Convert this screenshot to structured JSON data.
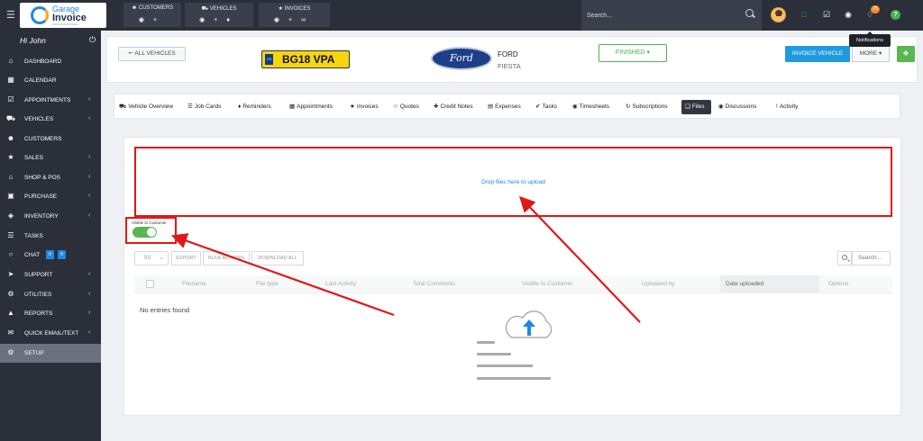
{
  "topbar": {
    "groups": [
      {
        "title": "CUSTOMERS",
        "icon": "user-icon"
      },
      {
        "title": "VEHICLES",
        "icon": "car-icon"
      },
      {
        "title": "INVOICES",
        "icon": "star-icon"
      }
    ],
    "search_placeholder": "Search...",
    "notification_count": "25",
    "notifications_tooltip": "Notifications"
  },
  "logo": {
    "line1": "Garage",
    "line2": "Invoice",
    "sub": "PROFESSIONAL"
  },
  "sidebar": {
    "greeting": "Hi John",
    "items": [
      {
        "label": "DASHBOARD",
        "icon": "home-icon"
      },
      {
        "label": "CALENDAR",
        "icon": "calendar-icon"
      },
      {
        "label": "APPOINTMENTS",
        "icon": "calendar-check-icon"
      },
      {
        "label": "VEHICLES",
        "icon": "car-icon"
      },
      {
        "label": "CUSTOMERS",
        "icon": "user-icon"
      },
      {
        "label": "SALES",
        "icon": "star-icon"
      },
      {
        "label": "SHOP & POS",
        "icon": "shop-icon"
      },
      {
        "label": "PURCHASE",
        "icon": "cart-icon"
      },
      {
        "label": "INVENTORY",
        "icon": "box-icon"
      },
      {
        "label": "TASKS",
        "icon": "list-icon"
      },
      {
        "label": "CHAT",
        "icon": "chat-icon",
        "badges": [
          "0",
          "0"
        ]
      },
      {
        "label": "SUPPORT",
        "icon": "send-icon"
      },
      {
        "label": "UTILITIES",
        "icon": "cogs-icon"
      },
      {
        "label": "REPORTS",
        "icon": "chart-icon"
      },
      {
        "label": "QUICK EMAIL/TEXT",
        "icon": "envelope-icon"
      },
      {
        "label": "SETUP",
        "icon": "gear-icon"
      }
    ]
  },
  "header": {
    "back_label": "ALL VEHICLES",
    "plate_country": "GB",
    "plate_number": "BG18 VPA",
    "brand_logo_text": "Ford",
    "make": "FORD",
    "model": "FIESTA",
    "status": "FINISHED",
    "invoice_button": "INVOICE VEHICLE",
    "more_button": "MORE"
  },
  "tabs": [
    {
      "label": "Vehicle Overview",
      "icon": "car-icon"
    },
    {
      "label": "Job Cards",
      "icon": "list-icon"
    },
    {
      "label": "Reminders",
      "icon": "bell-icon"
    },
    {
      "label": "Appointments",
      "icon": "calendar-icon"
    },
    {
      "label": "Invoices",
      "icon": "star-icon"
    },
    {
      "label": "Quotes",
      "icon": "star-outline-icon"
    },
    {
      "label": "Credit Notes",
      "icon": "plus-icon"
    },
    {
      "label": "Expenses",
      "icon": "receipt-icon"
    },
    {
      "label": "Tasks",
      "icon": "check-circle-icon"
    },
    {
      "label": "Timesheets",
      "icon": "clock-icon"
    },
    {
      "label": "Subscriptions",
      "icon": "refresh-icon"
    },
    {
      "label": "Files",
      "icon": "files-icon",
      "active": true
    },
    {
      "label": "Discussions",
      "icon": "comment-icon"
    },
    {
      "label": "Activity",
      "icon": "exclamation-icon"
    }
  ],
  "files": {
    "dropzone_text": "Drop files here to upload",
    "visible_label": "Visible to Customer",
    "visible_on": true,
    "per_page": "50",
    "toolbar": [
      "EXPORT",
      "BULK ACTIONS",
      "DOWNLOAD ALL"
    ],
    "search_placeholder": "Search...",
    "columns": [
      "Filename",
      "File type",
      "Last Activity",
      "Total Comments",
      "Visible to Customer",
      "Uploaded by",
      "Date uploaded",
      "Options"
    ],
    "sorted_column": "Date uploaded",
    "empty_text": "No entries found"
  },
  "colors": {
    "accent": "#1e9be0",
    "success": "#5ab552",
    "highlight": "#e01818"
  }
}
